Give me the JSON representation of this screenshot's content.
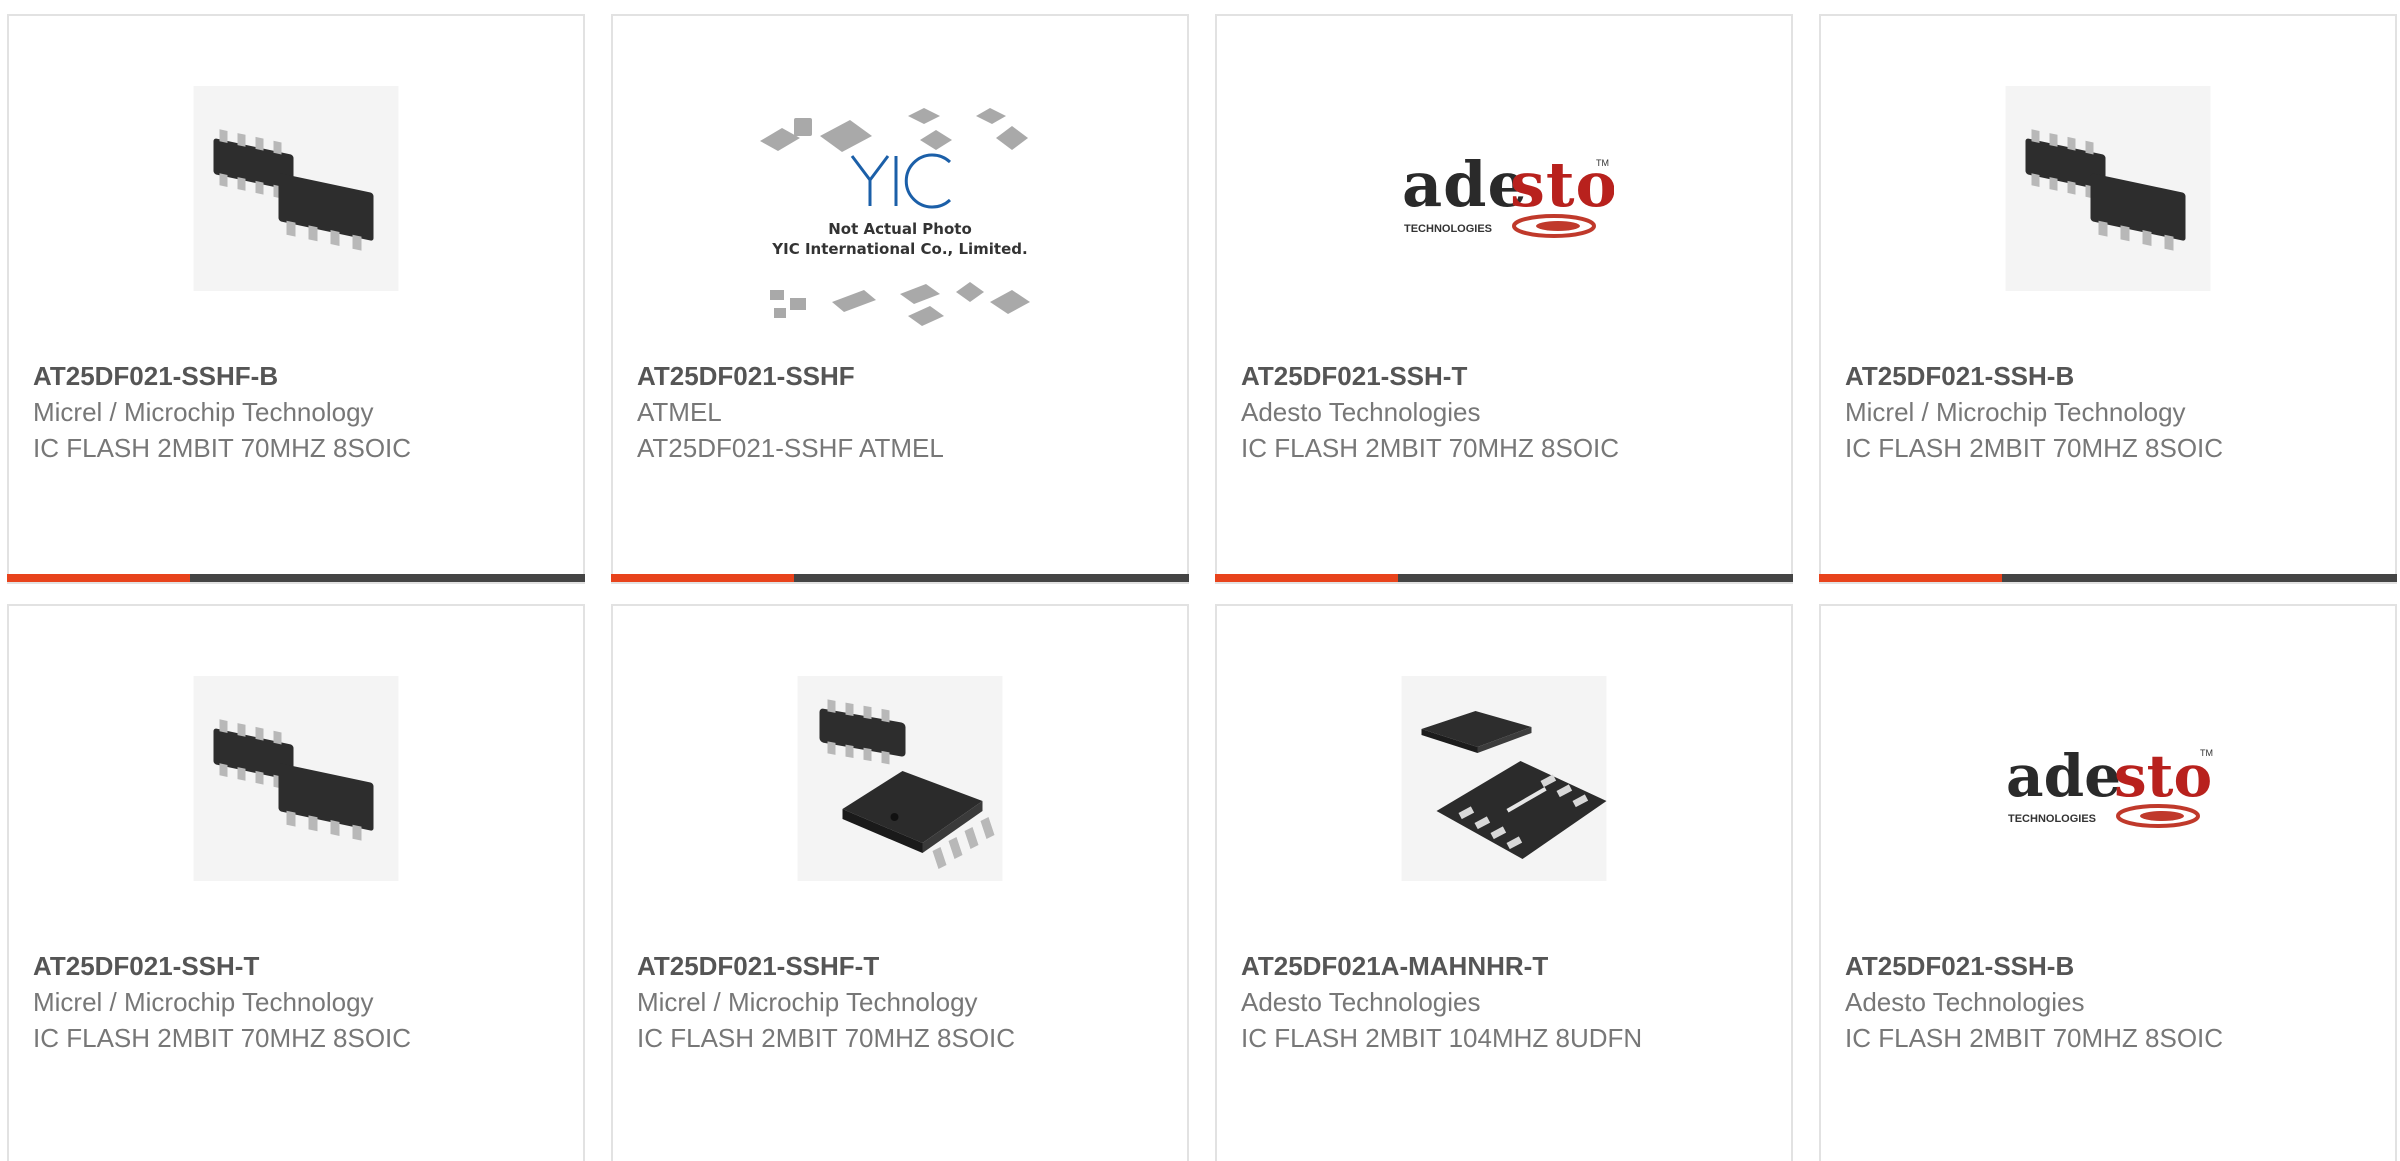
{
  "colors": {
    "accent": "#e8431c",
    "bar": "#444444",
    "border": "#e2e2e2",
    "part_number": "#555555",
    "secondary_text": "#777777"
  },
  "products": [
    {
      "part_number": "AT25DF021-SSHF-B",
      "manufacturer": "Micrel / Microchip Technology",
      "description": "IC FLASH 2MBIT 70MHZ 8SOIC",
      "image_type": "soic-pair-icon"
    },
    {
      "part_number": "AT25DF021-SSHF",
      "manufacturer": "ATMEL",
      "description": "AT25DF021-SSHF ATMEL",
      "image_type": "yic-placeholder-icon",
      "placeholder_line1": "Not Actual Photo",
      "placeholder_line2": "YIC International Co., Limited."
    },
    {
      "part_number": "AT25DF021-SSH-T",
      "manufacturer": "Adesto Technologies",
      "description": "IC FLASH 2MBIT 70MHZ 8SOIC",
      "image_type": "adesto-logo",
      "logo_word_dark": "ade",
      "logo_word_red": "sto",
      "logo_sub": "TECHNOLOGIES",
      "logo_tm": "TM"
    },
    {
      "part_number": "AT25DF021-SSH-B",
      "manufacturer": "Micrel / Microchip Technology",
      "description": "IC FLASH 2MBIT 70MHZ 8SOIC",
      "image_type": "soic-pair-icon"
    },
    {
      "part_number": "AT25DF021-SSH-T",
      "manufacturer": "Micrel / Microchip Technology",
      "description": "IC FLASH 2MBIT 70MHZ 8SOIC",
      "image_type": "soic-pair-icon"
    },
    {
      "part_number": "AT25DF021-SSHF-T",
      "manufacturer": "Micrel / Microchip Technology",
      "description": "IC FLASH 2MBIT 70MHZ 8SOIC",
      "image_type": "soic-pair-large-icon"
    },
    {
      "part_number": "AT25DF021A-MAHNHR-T",
      "manufacturer": "Adesto Technologies",
      "description": "IC FLASH 2MBIT 104MHZ 8UDFN",
      "image_type": "udfn-chip-icon"
    },
    {
      "part_number": "AT25DF021-SSH-B",
      "manufacturer": "Adesto Technologies",
      "description": "IC FLASH 2MBIT 70MHZ 8SOIC",
      "image_type": "adesto-logo",
      "logo_word_dark": "ade",
      "logo_word_red": "sto",
      "logo_sub": "TECHNOLOGIES",
      "logo_tm": "TM"
    }
  ]
}
